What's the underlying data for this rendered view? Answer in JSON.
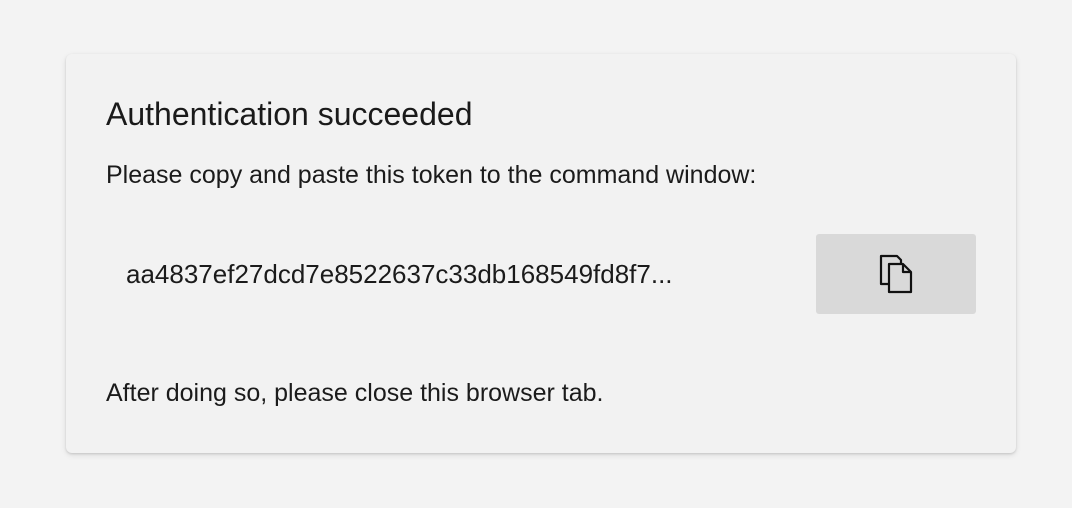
{
  "card": {
    "title": "Authentication succeeded",
    "instruction": "Please copy and paste this token to the command window:",
    "token": "aa4837ef27dcd7e8522637c33db168549fd8f7...",
    "copy_icon": "copy-icon",
    "footer": "After doing so, please close this browser tab."
  }
}
